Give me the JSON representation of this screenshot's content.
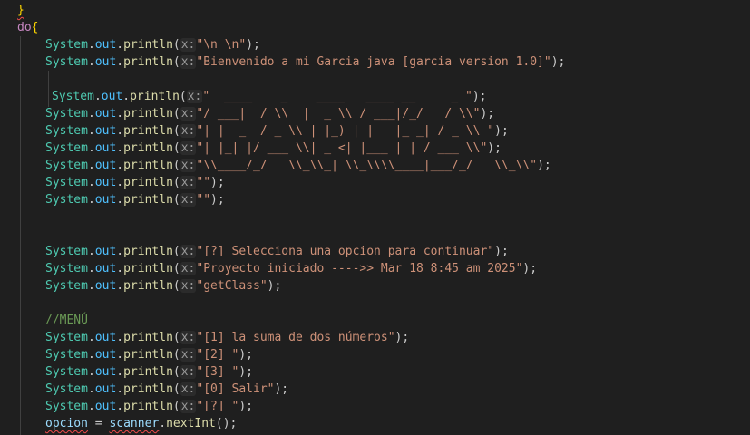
{
  "editor": {
    "language": "java",
    "lines": [
      {
        "kind": "brace-close",
        "text": "}"
      },
      {
        "kind": "do-open",
        "keyword": "do",
        "brace": "{"
      },
      {
        "kind": "println",
        "arg": "\"\\n \\n\""
      },
      {
        "kind": "println",
        "arg": "\"Bienvenido a mi Garcia java [garcia version 1.0]\""
      },
      {
        "kind": "blank"
      },
      {
        "kind": "println",
        "arg": "\"  ____    _    ____   ____ __     _ \""
      },
      {
        "kind": "println",
        "arg": "\"/ ___|  / \\\\  |  _ \\\\ / ___|/_/   / \\\\\""
      },
      {
        "kind": "println",
        "arg": "\"| |  _  / _ \\\\ | |_) | |   |_ _| / _ \\\\ \""
      },
      {
        "kind": "println",
        "arg": "\"| |_| |/ ___ \\\\| _ <| |___ | | / ___ \\\\\""
      },
      {
        "kind": "println",
        "arg": "\"\\\\____/_/   \\\\_\\\\_| \\\\_\\\\\\\\____|___/_/   \\\\_\\\\\""
      },
      {
        "kind": "println",
        "arg": "\"\""
      },
      {
        "kind": "println",
        "arg": "\"\""
      },
      {
        "kind": "blank"
      },
      {
        "kind": "blank"
      },
      {
        "kind": "println",
        "arg": "\"[?] Selecciona una opcion para continuar\""
      },
      {
        "kind": "println",
        "arg": "\"Proyecto iniciado ---->> Mar 18 8:45 am 2025\""
      },
      {
        "kind": "println",
        "arg": "\"getClass\""
      },
      {
        "kind": "blank"
      },
      {
        "kind": "comment",
        "text": "//MENÚ"
      },
      {
        "kind": "println",
        "arg": "\"[1] la suma de dos números\""
      },
      {
        "kind": "println",
        "arg": "\"[2] \""
      },
      {
        "kind": "println",
        "arg": "\"[3] \""
      },
      {
        "kind": "println",
        "arg": "\"[0] Salir\""
      },
      {
        "kind": "println",
        "arg": "\"[?] \""
      },
      {
        "kind": "assign",
        "target": "opcion",
        "op": " = ",
        "obj": "scanner",
        "call": "nextInt",
        "tail": "();"
      }
    ],
    "tokens": {
      "cls": "System",
      "dot": ".",
      "fld": "out",
      "mth": "println",
      "paren_open": "(",
      "hint": "x:",
      "tail": ");"
    },
    "colors": {
      "background": "#1f1f1f",
      "class": "#4ec9b0",
      "field": "#4fc1ff",
      "method": "#dcdcaa",
      "string": "#ce9178",
      "keyword": "#c586c0",
      "comment": "#6a9955",
      "variable": "#9cdcfe",
      "error_squiggle": "#f14c4c"
    }
  }
}
